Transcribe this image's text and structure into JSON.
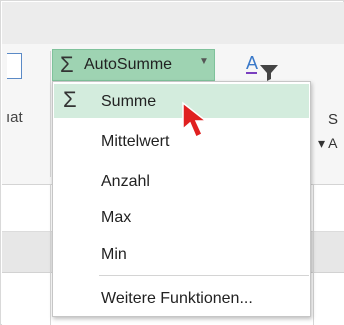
{
  "ribbon": {
    "left_truncated_text": "ıat",
    "autosum": {
      "label": "AutoSumme",
      "symbol": "Σ"
    },
    "right_truncated_s": "S",
    "right_truncated_a": "A"
  },
  "menu": {
    "items": [
      {
        "label": "Summe",
        "symbol": "Σ"
      },
      {
        "label": "Mittelwert"
      },
      {
        "label": "Anzahl"
      },
      {
        "label": "Max"
      },
      {
        "label": "Min"
      },
      {
        "label": "Weitere Funktionen..."
      }
    ]
  },
  "colors": {
    "accent": "#9ed3b2",
    "hover": "#d3ecdd",
    "cursor": "#e02020"
  },
  "icons": [
    "sigma-icon",
    "dropdown-caret-icon",
    "sort-filter-icon",
    "mouse-cursor-icon"
  ]
}
